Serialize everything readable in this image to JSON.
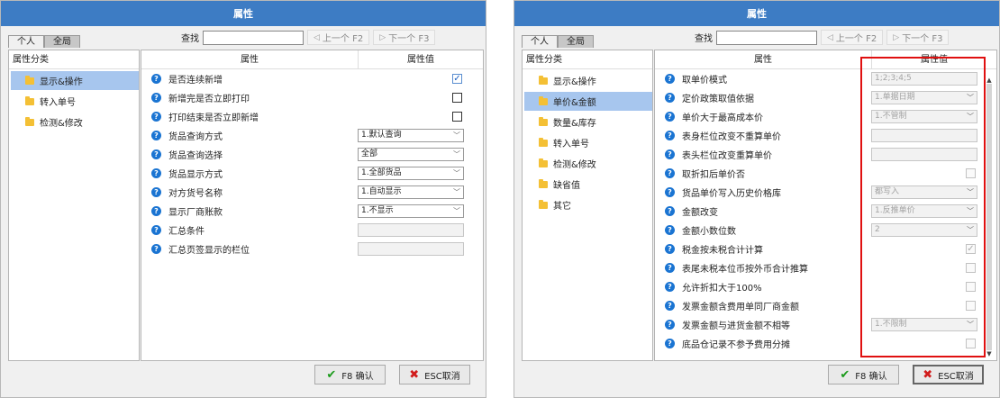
{
  "windows": [
    {
      "title": "属性",
      "tabs": [
        {
          "label": "个人",
          "active": false
        },
        {
          "label": "全局",
          "active": true
        }
      ],
      "search": {
        "label": "查找",
        "value": "",
        "prev": "上一个 F2",
        "next": "下一个 F3"
      },
      "categories": {
        "header": "属性分类",
        "items": [
          {
            "label": "显示&操作",
            "selected": true
          },
          {
            "label": "转入单号",
            "selected": false
          },
          {
            "label": "检测&修改",
            "selected": false
          }
        ]
      },
      "props": {
        "col_name": "属性",
        "col_value": "属性值",
        "rows": [
          {
            "name": "是否连续新增",
            "kind": "check",
            "checked": true,
            "disabled": false
          },
          {
            "name": "新增完是否立即打印",
            "kind": "check",
            "checked": false,
            "disabled": false
          },
          {
            "name": "打印结束是否立即新增",
            "kind": "check",
            "checked": false,
            "disabled": false
          },
          {
            "name": "货品查询方式",
            "kind": "select",
            "value": "1.默认查询",
            "disabled": false
          },
          {
            "name": "货品查询选择",
            "kind": "select",
            "value": "全部",
            "disabled": false
          },
          {
            "name": "货品显示方式",
            "kind": "select",
            "value": "1.全部货品",
            "disabled": false
          },
          {
            "name": "对方货号名称",
            "kind": "select",
            "value": "1.自动显示",
            "disabled": false
          },
          {
            "name": "显示厂商账款",
            "kind": "select",
            "value": "1.不显示",
            "disabled": false
          },
          {
            "name": "汇总条件",
            "kind": "text",
            "value": "",
            "disabled": true
          },
          {
            "name": "汇总页签显示的栏位",
            "kind": "text",
            "value": "",
            "disabled": true
          }
        ]
      },
      "buttons": {
        "ok": "F8 确认",
        "cancel": "ESC取消"
      }
    },
    {
      "title": "属性",
      "tabs": [
        {
          "label": "个人",
          "active": false
        },
        {
          "label": "全局",
          "active": true
        }
      ],
      "search": {
        "label": "查找",
        "value": "",
        "prev": "上一个 F2",
        "next": "下一个 F3"
      },
      "categories": {
        "header": "属性分类",
        "items": [
          {
            "label": "显示&操作",
            "selected": false
          },
          {
            "label": "单价&金额",
            "selected": true
          },
          {
            "label": "数量&库存",
            "selected": false
          },
          {
            "label": "转入单号",
            "selected": false
          },
          {
            "label": "检测&修改",
            "selected": false
          },
          {
            "label": "缺省值",
            "selected": false
          },
          {
            "label": "其它",
            "selected": false
          }
        ]
      },
      "props": {
        "col_name": "属性",
        "col_value": "属性值",
        "rows": [
          {
            "name": "取单价模式",
            "kind": "text",
            "value": "1;2;3;4;5",
            "disabled": true
          },
          {
            "name": "定价政策取值依据",
            "kind": "select",
            "value": "1.单据日期",
            "disabled": true
          },
          {
            "name": "单价大于最高成本价",
            "kind": "select",
            "value": "1.不管制",
            "disabled": true
          },
          {
            "name": "表身栏位改变不重算单价",
            "kind": "text",
            "value": "",
            "disabled": true
          },
          {
            "name": "表头栏位改变重算单价",
            "kind": "text",
            "value": "",
            "disabled": true
          },
          {
            "name": "取折扣后单价否",
            "kind": "check",
            "checked": false,
            "disabled": true
          },
          {
            "name": "货品单价写入历史价格库",
            "kind": "select",
            "value": "都写入",
            "disabled": true
          },
          {
            "name": "金额改变",
            "kind": "select",
            "value": "1.反推单价",
            "disabled": true
          },
          {
            "name": "金额小数位数",
            "kind": "select",
            "value": "2",
            "disabled": true
          },
          {
            "name": "税金按未税合计计算",
            "kind": "check",
            "checked": true,
            "disabled": true
          },
          {
            "name": "表尾未税本位币按外币合计推算",
            "kind": "check",
            "checked": false,
            "disabled": true
          },
          {
            "name": "允许折扣大于100%",
            "kind": "check",
            "checked": false,
            "disabled": true
          },
          {
            "name": "发票金额含费用单同厂商金额",
            "kind": "check",
            "checked": false,
            "disabled": true
          },
          {
            "name": "发票金额与进货金额不相等",
            "kind": "select",
            "value": "1.不限制",
            "disabled": true
          },
          {
            "name": "底品仓记录不参予费用分摊",
            "kind": "check",
            "checked": false,
            "disabled": true
          }
        ]
      },
      "buttons": {
        "ok": "F8 确认",
        "cancel": "ESC取消"
      }
    }
  ]
}
